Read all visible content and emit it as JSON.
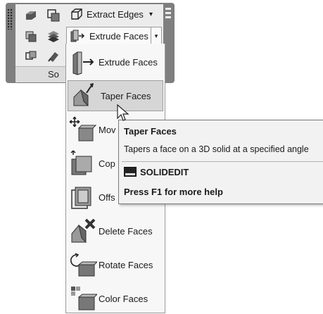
{
  "panel": {
    "footer_label": "So"
  },
  "toolbar": {
    "extract_edges_label": "Extract Edges",
    "extract_edges_dropdown": "▾",
    "extrude_faces_label": "Extrude Faces",
    "extrude_faces_dropdown": "▾"
  },
  "menu": {
    "items": [
      {
        "label": "Extrude Faces",
        "icon": "extrude-faces-icon"
      },
      {
        "label": "Taper Faces",
        "icon": "taper-faces-icon",
        "state": "hover"
      },
      {
        "label": "Mov",
        "icon": "move-faces-icon"
      },
      {
        "label": "Cop",
        "icon": "copy-faces-icon"
      },
      {
        "label": "Offs",
        "icon": "offset-faces-icon"
      },
      {
        "label": "Delete Faces",
        "icon": "delete-faces-icon"
      },
      {
        "label": "Rotate Faces",
        "icon": "rotate-faces-icon"
      },
      {
        "label": "Color Faces",
        "icon": "color-faces-icon"
      }
    ]
  },
  "tooltip": {
    "title": "Taper Faces",
    "description": "Tapers a face on a 3D solid at a specified angle",
    "command": "SOLIDEDIT",
    "help": "Press F1 for more help"
  },
  "colors": {
    "panel_frame": "#7f7f7f",
    "panel_bg": "#ececec",
    "menu_bg": "#f7f7f7",
    "hover_bg": "#d6d6d6",
    "tooltip_bg": "#f2f2f2"
  }
}
